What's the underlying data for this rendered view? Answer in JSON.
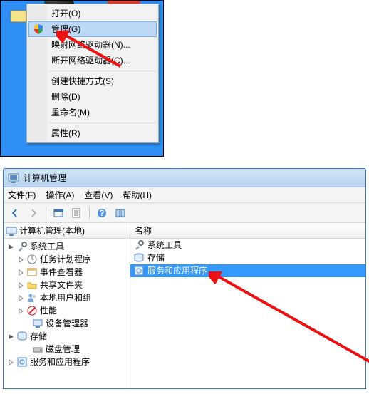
{
  "context_menu": {
    "items": [
      {
        "label": "打开(O)"
      },
      {
        "label": "管理(G)",
        "highlighted": true,
        "shield": true
      },
      {
        "label": "映射网络驱动器(N)..."
      },
      {
        "label": "断开网络驱动器(C)..."
      },
      {
        "label": "创建快捷方式(S)"
      },
      {
        "label": "删除(D)"
      },
      {
        "label": "重命名(M)"
      },
      {
        "label": "属性(R)"
      }
    ]
  },
  "window": {
    "title": "计算机管理",
    "menubar": [
      "文件(F)",
      "操作(A)",
      "查看(V)",
      "帮助(H)"
    ],
    "tree_header": "计算机管理(本地)",
    "list_header": "名称",
    "tree": {
      "sys_tools": "系统工具",
      "task_sched": "任务计划程序",
      "event_viewer": "事件查看器",
      "shared_folders": "共享文件夹",
      "local_users": "本地用户和组",
      "performance": "性能",
      "device_mgr": "设备管理器",
      "storage": "存储",
      "disk_mgmt": "磁盘管理",
      "services_apps": "服务和应用程序"
    },
    "list": {
      "sys_tools": "系统工具",
      "storage": "存储",
      "services_apps": "服务和应用程序"
    }
  }
}
